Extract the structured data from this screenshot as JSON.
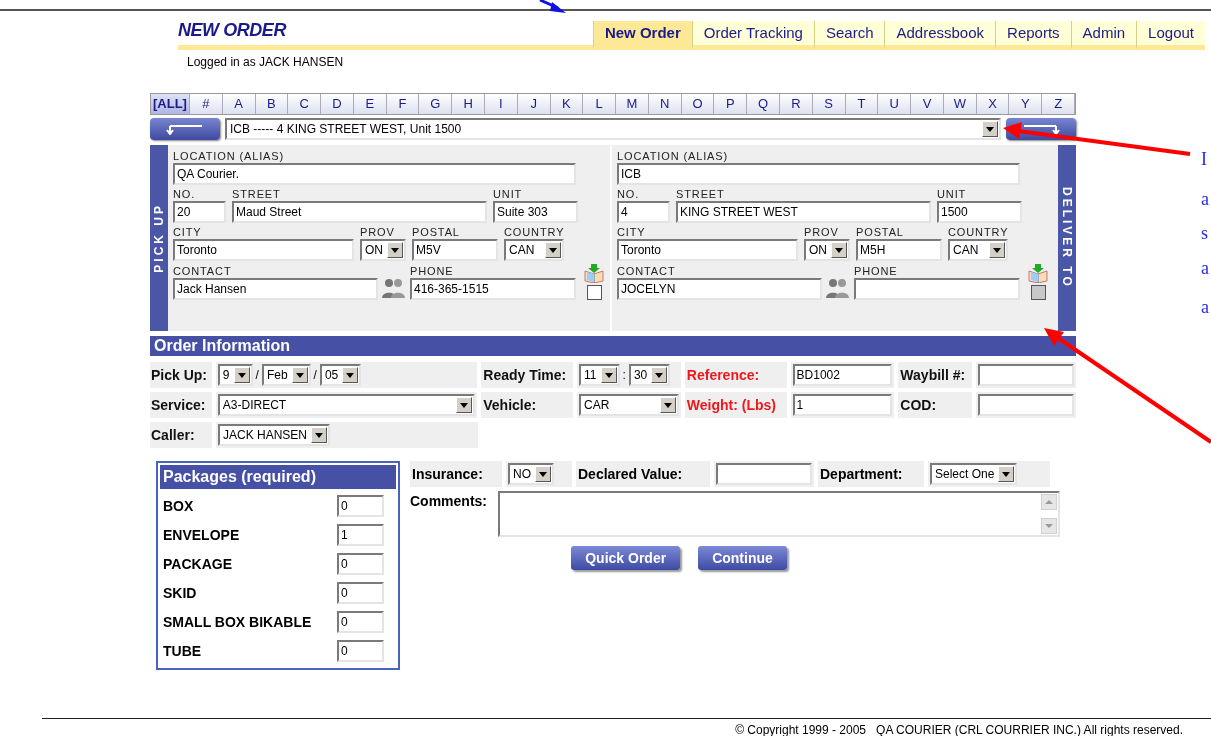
{
  "page_title": "NEW ORDER",
  "nav_tabs": [
    {
      "label": "New Order",
      "selected": true
    },
    {
      "label": "Order Tracking",
      "selected": false
    },
    {
      "label": "Search",
      "selected": false
    },
    {
      "label": "Addressbook",
      "selected": false
    },
    {
      "label": "Reports",
      "selected": false
    },
    {
      "label": "Admin",
      "selected": false
    },
    {
      "label": "Logout",
      "selected": false
    }
  ],
  "login_status": "Logged in as JACK HANSEN",
  "alphabet_filter": [
    {
      "label": "[ALL]",
      "selected": true
    },
    {
      "label": "#",
      "selected": false
    },
    {
      "label": "A",
      "selected": false
    },
    {
      "label": "B",
      "selected": false
    },
    {
      "label": "C",
      "selected": false
    },
    {
      "label": "D",
      "selected": false
    },
    {
      "label": "E",
      "selected": false
    },
    {
      "label": "F",
      "selected": false
    },
    {
      "label": "G",
      "selected": false
    },
    {
      "label": "H",
      "selected": false
    },
    {
      "label": "I",
      "selected": false
    },
    {
      "label": "J",
      "selected": false
    },
    {
      "label": "K",
      "selected": false
    },
    {
      "label": "L",
      "selected": false
    },
    {
      "label": "M",
      "selected": false
    },
    {
      "label": "N",
      "selected": false
    },
    {
      "label": "O",
      "selected": false
    },
    {
      "label": "P",
      "selected": false
    },
    {
      "label": "Q",
      "selected": false
    },
    {
      "label": "R",
      "selected": false
    },
    {
      "label": "S",
      "selected": false
    },
    {
      "label": "T",
      "selected": false
    },
    {
      "label": "U",
      "selected": false
    },
    {
      "label": "V",
      "selected": false
    },
    {
      "label": "W",
      "selected": false
    },
    {
      "label": "X",
      "selected": false
    },
    {
      "label": "Y",
      "selected": false
    },
    {
      "label": "Z",
      "selected": false
    }
  ],
  "address_select": {
    "value": "ICB ----- 4 KING STREET WEST, Unit 1500"
  },
  "addresses": [
    {
      "kind": "pickup",
      "side_label": "PICK UP",
      "location_label": "LOCATION (ALIAS)",
      "location": "QA Courier.",
      "no_label": "NO.",
      "no": "20",
      "street_label": "STREET",
      "street": "Maud Street",
      "unit_label": "UNIT",
      "unit": "Suite 303",
      "city_label": "CITY",
      "city": "Toronto",
      "prov_label": "PROV",
      "prov": "ON",
      "postal_label": "POSTAL",
      "postal": "M5V",
      "country_label": "COUNTRY",
      "country": "CAN",
      "contact_label": "CONTACT",
      "contact": "Jack Hansen",
      "phone_label": "PHONE",
      "phone": "416-365-1515",
      "checked": false,
      "disabled": false
    },
    {
      "kind": "deliver",
      "side_label": "DELIVER TO",
      "location_label": "LOCATION (ALIAS)",
      "location": "ICB",
      "no_label": "NO.",
      "no": "4",
      "street_label": "STREET",
      "street": "KING STREET WEST",
      "unit_label": "UNIT",
      "unit": "1500",
      "city_label": "CITY",
      "city": "Toronto",
      "prov_label": "PROV",
      "prov": "ON",
      "postal_label": "POSTAL",
      "postal": "M5H",
      "country_label": "COUNTRY",
      "country": "CAN",
      "contact_label": "CONTACT",
      "contact": "JOCELYN",
      "phone_label": "PHONE",
      "checked": false,
      "disabled": true
    }
  ],
  "order_information": {
    "title": "Order Information",
    "rows": [
      [
        {
          "label": "Pick Up:",
          "required": false,
          "controls": [
            {
              "kind": "select",
              "value": "9"
            },
            {
              "kind": "sep",
              "text": "/"
            },
            {
              "kind": "select",
              "value": "Feb"
            },
            {
              "kind": "sep",
              "text": "/"
            },
            {
              "kind": "select",
              "value": "05"
            }
          ]
        },
        {
          "label": "Ready Time:",
          "required": false,
          "controls": [
            {
              "kind": "select",
              "value": "11"
            },
            {
              "kind": "sep",
              "text": ":"
            },
            {
              "kind": "select",
              "value": "30"
            }
          ]
        },
        {
          "label": "Reference:",
          "required": true,
          "controls": [
            {
              "kind": "field",
              "value": "BD1002"
            }
          ]
        },
        {
          "label": "Waybill #:",
          "required": false,
          "controls": [
            {
              "kind": "field"
            }
          ]
        }
      ],
      [
        {
          "label": "Service:",
          "required": false,
          "controls": [
            {
              "kind": "wide_select",
              "value": "A3-DIRECT"
            }
          ]
        },
        {
          "label": "Vehicle:",
          "required": false,
          "controls": [
            {
              "kind": "wide_select",
              "value": "CAR"
            }
          ]
        },
        {
          "label": "Weight: (Lbs)",
          "required": true,
          "controls": [
            {
              "kind": "field",
              "value": "1"
            }
          ]
        },
        {
          "label": "COD:",
          "required": false,
          "controls": [
            {
              "kind": "field"
            }
          ]
        }
      ],
      [
        {
          "label": "Caller:",
          "required": false,
          "controls": [
            {
              "kind": "select",
              "value": "JACK HANSEN"
            }
          ]
        }
      ]
    ]
  },
  "packages": {
    "title": "Packages (required)",
    "items": [
      {
        "label": "BOX",
        "value": "0"
      },
      {
        "label": "ENVELOPE",
        "value": "1"
      },
      {
        "label": "PACKAGE",
        "value": "0"
      },
      {
        "label": "SKID",
        "value": "0"
      },
      {
        "label": "SMALL BOX BIKABLE",
        "value": "0"
      },
      {
        "label": "TUBE",
        "value": "0"
      }
    ]
  },
  "extra_fields": [
    {
      "label": "Insurance:",
      "control": {
        "kind": "select",
        "value": "NO"
      }
    },
    {
      "label": "Declared Value:",
      "control": {
        "kind": "field"
      }
    },
    {
      "label": "Department:",
      "control": {
        "kind": "select",
        "value": "Select One"
      }
    }
  ],
  "comments": {
    "label": "Comments:"
  },
  "buttons": [
    "Quick Order",
    "Continue"
  ],
  "footer": "© Copyright 1999 - 2005   QA COURIER (CRL COURRIER INC.) All rights reserved.",
  "margin_notes": [
    "I",
    "a",
    "s",
    "a",
    "a"
  ]
}
